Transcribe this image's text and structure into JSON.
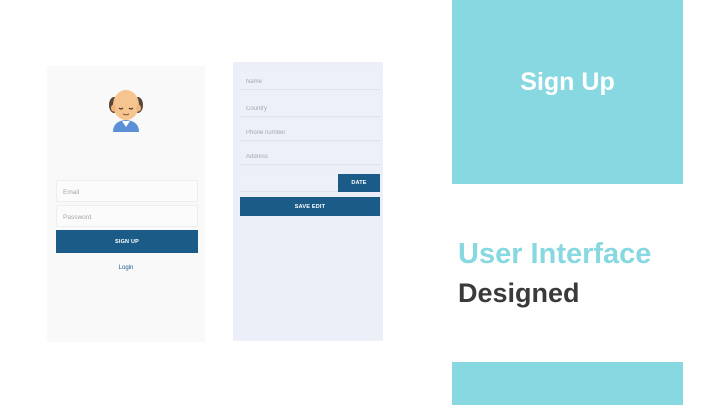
{
  "signup_screen": {
    "email_placeholder": "Email",
    "password_placeholder": "Password",
    "signup_button": "SIGN UP",
    "login_link": "Login"
  },
  "profile_screen": {
    "name_placeholder": "Name",
    "country_placeholder": "Country",
    "phone_placeholder": "Phone number",
    "address_placeholder": "Address",
    "date_button": "DATE",
    "save_button": "SAVE EDIT"
  },
  "slide": {
    "panel_title": "Sign Up",
    "headline_line1": "User Interface",
    "headline_line2": "Designed"
  },
  "colors": {
    "accent_teal": "#87d8e0",
    "button_blue": "#1b5b87",
    "headline_dark": "#3a3a3a"
  },
  "icons": {
    "avatar": "bald-man-avatar-icon"
  }
}
